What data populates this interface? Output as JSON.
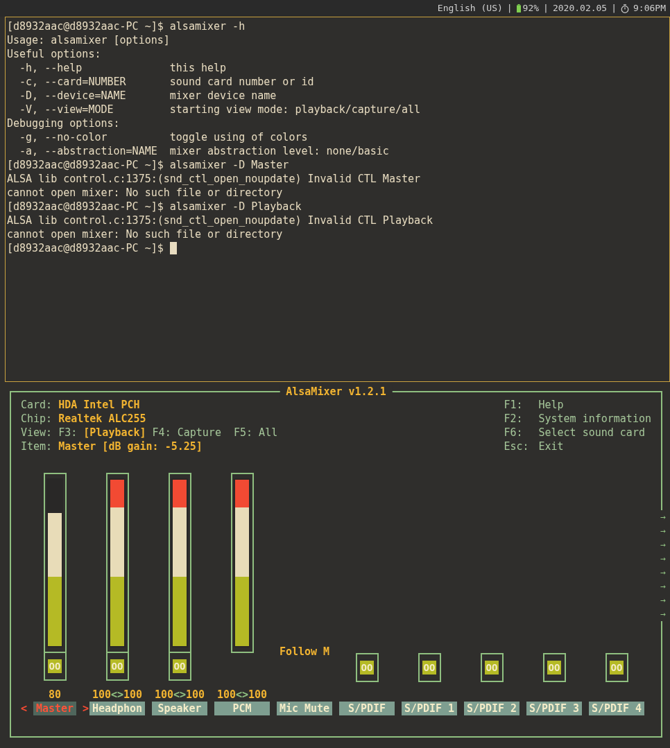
{
  "status_bar": {
    "language": "English (US)",
    "battery": "92%",
    "date": "2020.02.05",
    "time": "9:06PM",
    "separators": [
      "|",
      "|",
      "|"
    ]
  },
  "terminal": {
    "lines": [
      "[d8932aac@d8932aac-PC ~]$ alsamixer -h",
      "Usage: alsamixer [options]",
      "Useful options:",
      "  -h, --help              this help",
      "  -c, --card=NUMBER       sound card number or id",
      "  -D, --device=NAME       mixer device name",
      "  -V, --view=MODE         starting view mode: playback/capture/all",
      "Debugging options:",
      "  -g, --no-color          toggle using of colors",
      "  -a, --abstraction=NAME  mixer abstraction level: none/basic",
      "[d8932aac@d8932aac-PC ~]$ alsamixer -D Master",
      "ALSA lib control.c:1375:(snd_ctl_open_noupdate) Invalid CTL Master",
      "cannot open mixer: No such file or directory",
      "[d8932aac@d8932aac-PC ~]$ alsamixer -D Playback",
      "ALSA lib control.c:1375:(snd_ctl_open_noupdate) Invalid CTL Playback",
      "cannot open mixer: No such file or directory",
      "[d8932aac@d8932aac-PC ~]$"
    ],
    "cursor": true
  },
  "mixer": {
    "title": "AlsaMixer v1.2.1",
    "info": [
      {
        "parts": [
          {
            "text": "Card:",
            "highlight": false
          },
          {
            "text": "HDA Intel PCH",
            "highlight": true
          }
        ]
      },
      {
        "parts": [
          {
            "text": "Chip:",
            "highlight": false
          },
          {
            "text": "Realtek ALC255",
            "highlight": true
          }
        ]
      },
      {
        "parts": [
          {
            "text": "View: F3:",
            "highlight": false
          },
          {
            "text": "[Playback]",
            "highlight": true
          },
          {
            "text": "F4: Capture  F5: All",
            "highlight": false
          }
        ]
      },
      {
        "parts": [
          {
            "text": "Item:",
            "highlight": false
          },
          {
            "text": "Master [dB gain: -5.25]",
            "highlight": true
          }
        ]
      }
    ],
    "keys": [
      {
        "key": "F1:",
        "action": "Help"
      },
      {
        "key": "F2:",
        "action": "System information"
      },
      {
        "key": "F6:",
        "action": "Select sound card"
      },
      {
        "key": "Esc:",
        "action": "Exit"
      }
    ],
    "selection_marks": [
      "<",
      ">"
    ],
    "channels": [
      {
        "kind": "volume",
        "name": "Master",
        "selected": true,
        "level": 0.8,
        "mute": "OO",
        "muted": false,
        "value_parts": [
          "80"
        ]
      },
      {
        "kind": "volume",
        "name": "Headphon",
        "selected": false,
        "level": 1,
        "mute": "OO",
        "muted": false,
        "value_parts": [
          "100",
          "<>",
          "100"
        ]
      },
      {
        "kind": "volume",
        "name": "Speaker",
        "selected": false,
        "level": 1,
        "mute": "OO",
        "muted": false,
        "value_parts": [
          "100",
          "<>",
          "100"
        ]
      },
      {
        "kind": "volume_only",
        "name": "PCM",
        "selected": false,
        "level": 1,
        "value_parts": [
          "100",
          "<>",
          "100"
        ]
      },
      {
        "kind": "enum",
        "name": "Mic Mute",
        "selected": false,
        "option": "Follow M"
      },
      {
        "kind": "switch",
        "name": "S/PDIF",
        "selected": false,
        "mute": "OO",
        "muted": false
      },
      {
        "kind": "switch",
        "name": "S/PDIF 1",
        "selected": false,
        "mute": "OO",
        "muted": false
      },
      {
        "kind": "switch",
        "name": "S/PDIF 2",
        "selected": false,
        "mute": "OO",
        "muted": false
      },
      {
        "kind": "switch",
        "name": "S/PDIF 3",
        "selected": false,
        "mute": "OO",
        "muted": false
      },
      {
        "kind": "switch",
        "name": "S/PDIF 4",
        "selected": false,
        "mute": "OO",
        "muted": false
      }
    ],
    "more_arrows": [
      "→",
      "→",
      "→",
      "→",
      "→",
      "→",
      "→",
      "→"
    ]
  }
}
